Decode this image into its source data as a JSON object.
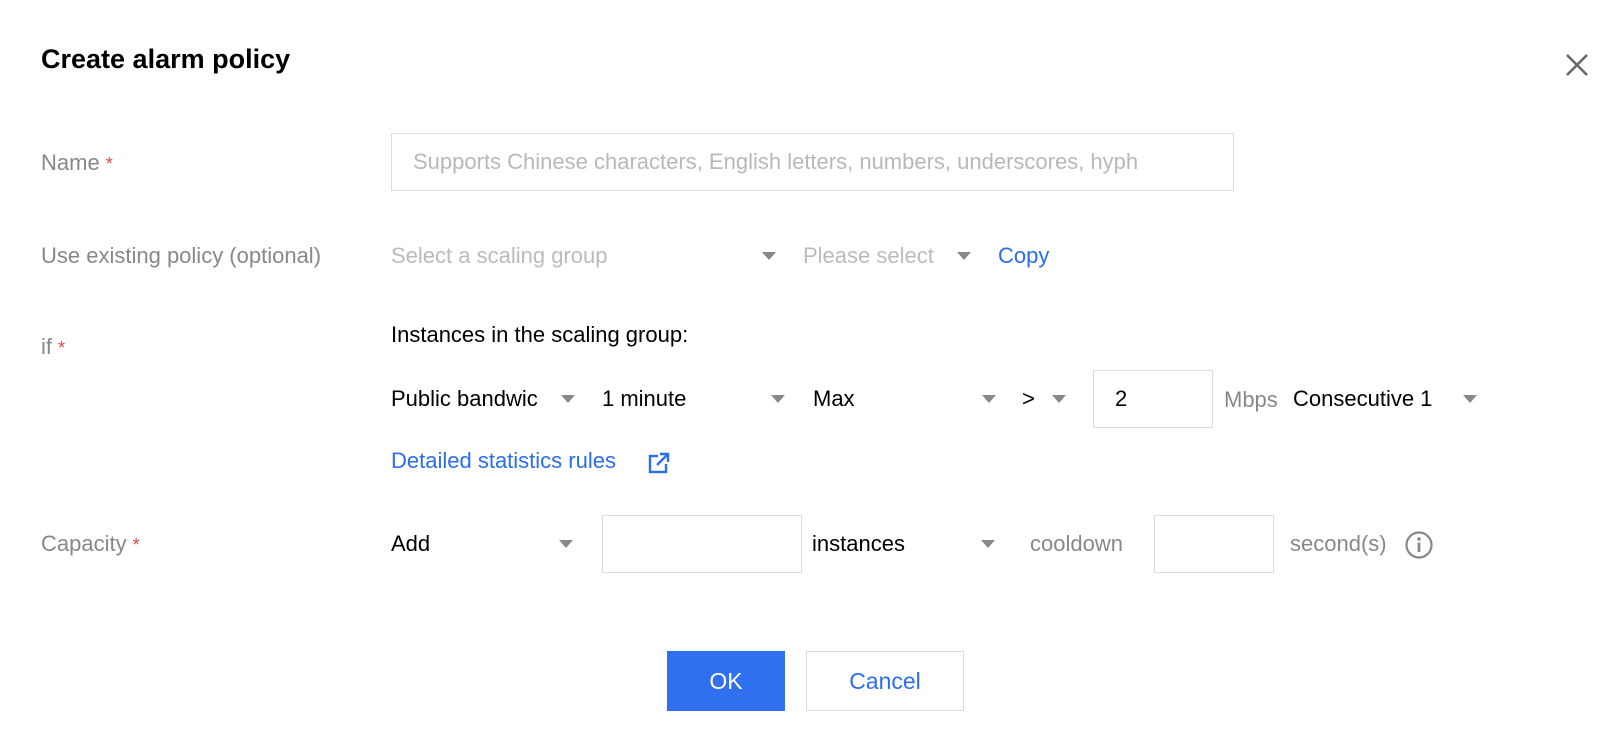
{
  "dialog": {
    "title": "Create alarm policy"
  },
  "name_field": {
    "label": "Name",
    "required_mark": "*",
    "placeholder": "Supports Chinese characters, English letters, numbers, underscores, hyph"
  },
  "existing_policy": {
    "label": "Use existing policy (optional)",
    "scaling_group_placeholder": "Select a scaling group",
    "policy_placeholder": "Please select",
    "copy_label": "Copy"
  },
  "condition": {
    "label": "if",
    "required_mark": "*",
    "intro": "Instances in the scaling group:",
    "metric": "Public bandwic",
    "period": "1 minute",
    "statistic": "Max",
    "operator": ">",
    "threshold": "2",
    "unit": "Mbps",
    "consecutive": "Consecutive 1",
    "stats_rules_link": "Detailed statistics rules"
  },
  "capacity": {
    "label": "Capacity",
    "required_mark": "*",
    "action": "Add",
    "amount": "",
    "unit": "instances",
    "cooldown_label": "cooldown",
    "cooldown_value": "",
    "seconds_label": "second(s)"
  },
  "buttons": {
    "ok": "OK",
    "cancel": "Cancel"
  },
  "colors": {
    "primary": "#2f6ff0",
    "link": "#2b6df0",
    "required": "#e54545"
  }
}
